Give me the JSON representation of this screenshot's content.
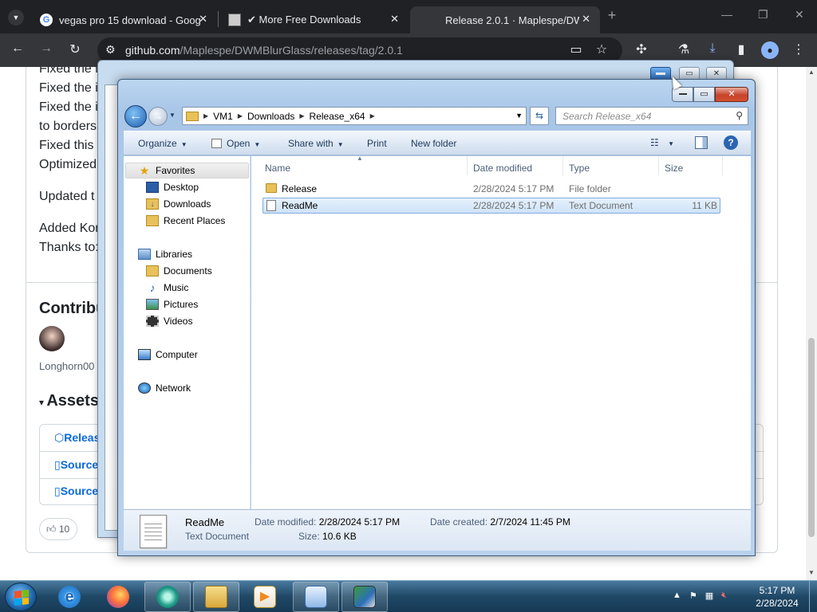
{
  "browser": {
    "tabs": [
      {
        "title": "vegas pro 15 download - Goog",
        "favicon": "google-icon"
      },
      {
        "title": "✔ More Free Downloads",
        "favicon": "site-icon"
      },
      {
        "title": "Release 2.0.1 · Maplespe/DWM",
        "favicon": "github-icon"
      }
    ],
    "url_host": "github.com",
    "url_path": "/Maplespe/DWMBlurGlass/releases/tag/2.0.1"
  },
  "page": {
    "lines": [
      "Fixed the i",
      "Fixed the i",
      "Fixed the i",
      "to borders",
      "Fixed this i",
      "Optimized",
      "Updated t",
      "Added Kor",
      "Thanks to:"
    ],
    "contributors_heading": "Contribu",
    "contributor_name": "Longhorn00",
    "assets_heading": "Assets",
    "assets": [
      "Releas",
      "Source",
      "Source"
    ],
    "reaction_count": "10"
  },
  "explorer": {
    "breadcrumb": [
      "VM1",
      "Downloads",
      "Release_x64"
    ],
    "search_placeholder": "Search Release_x64",
    "commands": {
      "organize": "Organize",
      "open": "Open",
      "share": "Share with",
      "print": "Print",
      "new_folder": "New folder"
    },
    "nav": {
      "favorites": "Favorites",
      "desktop": "Desktop",
      "downloads": "Downloads",
      "recent": "Recent Places",
      "libraries": "Libraries",
      "documents": "Documents",
      "music": "Music",
      "pictures": "Pictures",
      "videos": "Videos",
      "computer": "Computer",
      "network": "Network"
    },
    "columns": {
      "name": "Name",
      "date": "Date modified",
      "type": "Type",
      "size": "Size"
    },
    "files": [
      {
        "name": "Release",
        "date": "2/28/2024 5:17 PM",
        "type": "File folder",
        "size": ""
      },
      {
        "name": "ReadMe",
        "date": "2/28/2024 5:17 PM",
        "type": "Text Document",
        "size": "11 KB"
      }
    ],
    "details": {
      "name": "ReadMe",
      "type": "Text Document",
      "modified_label": "Date modified:",
      "modified": "2/28/2024 5:17 PM",
      "created_label": "Date created:",
      "created": "2/7/2024 11:45 PM",
      "size_label": "Size:",
      "size": "10.6 KB"
    }
  },
  "taskbar": {
    "time": "5:17 PM",
    "date": "2/28/2024"
  }
}
